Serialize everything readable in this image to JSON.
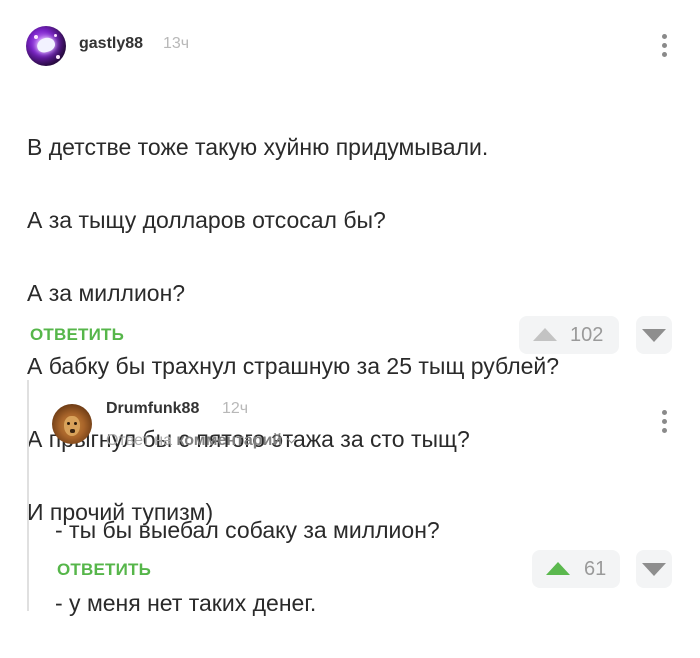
{
  "comment1": {
    "username": "gastly88",
    "time": "13ч",
    "lines": [
      "В детстве тоже такую хуйню придумывали.",
      "А за тыщу долларов отсосал бы?",
      "А за миллион?",
      "А бабку бы трахнул страшную за 25 тыщ рублей?",
      "А прыгнул бы с пятого этажа за сто тыщ?",
      "И прочий тупизм)"
    ],
    "reply_label": "ОТВЕТИТЬ",
    "votes": "102",
    "vote_up_color": "#c3c3c3"
  },
  "comment2": {
    "username": "Drumfunk88",
    "time": "12ч",
    "reply_prefix": "Ответ на",
    "reply_target": "комментарий",
    "lines": [
      "- ты бы выебал собаку за миллион?",
      "- у меня нет таких денег."
    ],
    "reply_label": "ОТВЕТИТЬ",
    "votes": "61",
    "vote_up_color": "#5bb84e"
  },
  "colors": {
    "accent_green": "#56b64a",
    "vote_bg": "#f3f4f5",
    "muted": "#b8b8b8"
  },
  "icons": [
    "more-vertical-icon",
    "arrow-up-icon",
    "arrow-down-icon",
    "chevron-down-icon",
    "avatar"
  ]
}
